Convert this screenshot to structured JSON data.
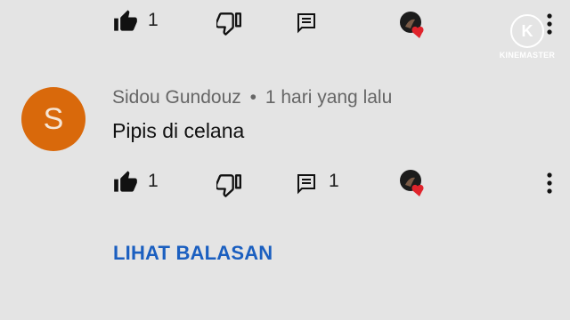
{
  "top_actions": {
    "like_count": "1"
  },
  "comment": {
    "avatar_letter": "S",
    "author": "Sidou Gundouz",
    "separator": "•",
    "time": "1 hari yang lalu",
    "text": "Pipis di celana",
    "like_count": "1",
    "reply_count": "1"
  },
  "view_replies_label": "LIHAT BALASAN",
  "watermark": {
    "text": "KINEMASTER",
    "logo_letter": "K"
  },
  "colors": {
    "background": "#e4e4e4",
    "avatar": "#d9690b",
    "link": "#1b5fc0",
    "heart": "#e0242c"
  },
  "icons": [
    "like-icon",
    "dislike-icon",
    "reply-icon",
    "creator-heart-icon",
    "more-vert-icon"
  ]
}
